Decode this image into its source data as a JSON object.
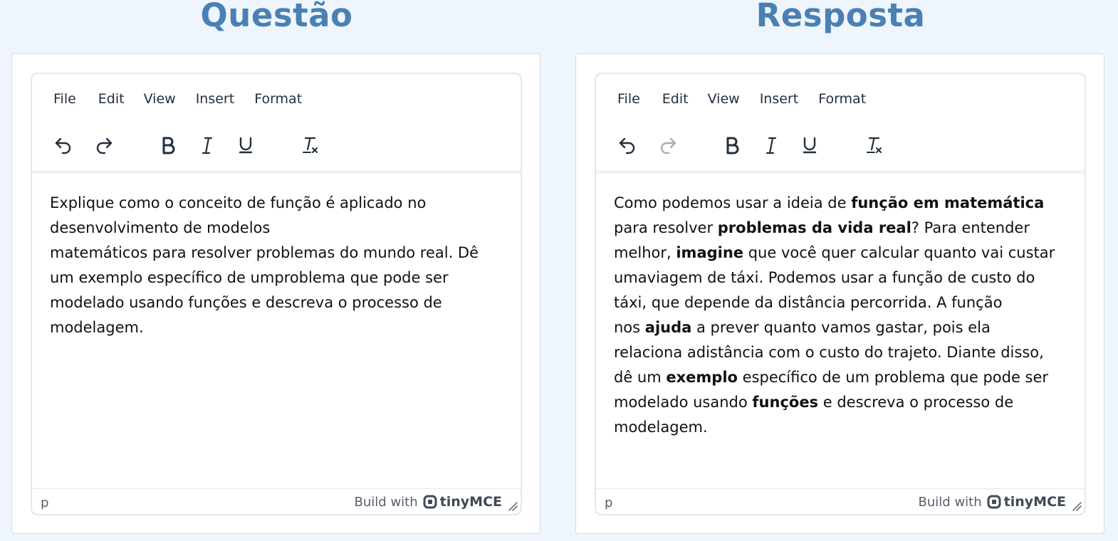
{
  "left": {
    "title": "Questão",
    "menu": [
      "File",
      "Edit",
      "View",
      "Insert",
      "Format"
    ],
    "toolbar": [
      "undo-icon",
      "redo-icon",
      "bold-icon",
      "italic-icon",
      "underline-icon",
      "clear-formatting-icon"
    ],
    "redo_enabled": true,
    "content_lines": [
      "Explique como o conceito de função é aplicado no",
      "desenvolvimento de modelos",
      "matemáticos para resolver problemas do mundo real. Dê",
      "um exemplo específico de umproblema que pode ser",
      "modelado usando funções e descreva o processo de",
      "modelagem."
    ],
    "status_path": "p",
    "branding_prefix": "Build with",
    "branding_name": "tinyMCE"
  },
  "right": {
    "title": "Resposta",
    "menu": [
      "File",
      "Edit",
      "View",
      "Insert",
      "Format"
    ],
    "toolbar": [
      "undo-icon",
      "redo-icon",
      "bold-icon",
      "italic-icon",
      "underline-icon",
      "clear-formatting-icon"
    ],
    "redo_enabled": false,
    "content": {
      "l1_a": "Como podemos usar a ideia de ",
      "l1_b": "função em matemática",
      "l2_a": "para resolver ",
      "l2_b": "problemas da vida real",
      "l2_c": "? Para entender",
      "l3_a": "melhor, ",
      "l3_b": "imagine",
      "l3_c": " que você quer calcular quanto vai custar",
      "l4": "umaviagem de táxi. Podemos usar a função de custo do",
      "l5": "táxi, que depende da distância percorrida. A função",
      "l6_a": "nos ",
      "l6_b": "ajuda",
      "l6_c": " a prever quanto vamos gastar, pois ela",
      "l7": "relaciona adistância com o custo do trajeto. Diante disso,",
      "l8_a": "dê um ",
      "l8_b": "exemplo",
      "l8_c": " específico de um problema que pode ser",
      "l9_a": "modelado usando ",
      "l9_b": "funções",
      "l9_c": " e descreva o processo de",
      "l10": "modelagem."
    },
    "status_path": "p",
    "branding_prefix": "Build with",
    "branding_name": "tinyMCE"
  },
  "colors": {
    "background": "#eef5fc",
    "title": "#4a80b3",
    "icon": "#222f3e",
    "icon_disabled": "#a6adb6"
  }
}
